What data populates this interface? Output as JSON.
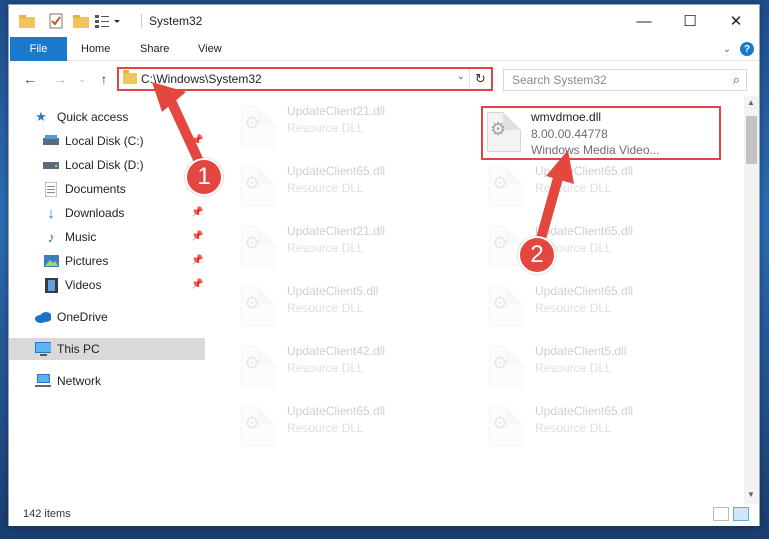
{
  "window": {
    "title": "System32",
    "controls": {
      "minimize": "—",
      "maximize": "☐",
      "close": "✕"
    }
  },
  "ribbon": {
    "file_tab": "File",
    "tabs": [
      "Home",
      "Share",
      "View"
    ]
  },
  "navbar": {
    "address_path": "C:\\Windows\\System32",
    "search_placeholder": "Search System32"
  },
  "sidebar": {
    "items": [
      {
        "label": "Quick access",
        "icon": "star-icon",
        "pinned": false
      },
      {
        "label": "Local Disk (C:)",
        "icon": "drive-icon",
        "pinned": true
      },
      {
        "label": "Local Disk (D:)",
        "icon": "drive-icon",
        "pinned": false
      },
      {
        "label": "Documents",
        "icon": "document-icon",
        "pinned": true
      },
      {
        "label": "Downloads",
        "icon": "download-icon",
        "pinned": true
      },
      {
        "label": "Music",
        "icon": "music-icon",
        "pinned": true
      },
      {
        "label": "Pictures",
        "icon": "picture-icon",
        "pinned": true
      },
      {
        "label": "Videos",
        "icon": "video-icon",
        "pinned": true
      },
      {
        "label": "OneDrive",
        "icon": "cloud-icon",
        "pinned": false
      },
      {
        "label": "This PC",
        "icon": "computer-icon",
        "pinned": false,
        "selected": true
      },
      {
        "label": "Network",
        "icon": "network-icon",
        "pinned": false
      }
    ]
  },
  "files": {
    "highlighted": {
      "name": "wmvdmoe.dll",
      "version": "8.00.00.44778",
      "description": "Windows Media Video..."
    },
    "left_column": [
      {
        "name": "UpdateClient21.dll",
        "type": "Resource DLL"
      },
      {
        "name": "UpdateClient65.dll",
        "type": "Resource DLL"
      },
      {
        "name": "UpdateClient21.dll",
        "type": "Resource DLL"
      },
      {
        "name": "UpdateClient5.dll",
        "type": "Resource DLL"
      },
      {
        "name": "UpdateClient42.dll",
        "type": "Resource DLL"
      },
      {
        "name": "UpdateClient65.dll",
        "type": "Resource DLL"
      }
    ],
    "right_column": [
      {
        "name": "UpdateClient65.dll",
        "type": "Resource DLL"
      },
      {
        "name": "UpdateClient65.dll",
        "type": "Resource DLL"
      },
      {
        "name": "UpdateClient65.dll",
        "type": "Resource DLL"
      },
      {
        "name": "UpdateClient5.dll",
        "type": "Resource DLL"
      },
      {
        "name": "UpdateClient65.dll",
        "type": "Resource DLL"
      }
    ]
  },
  "status": {
    "item_count": "142 items"
  },
  "annotations": {
    "step1": "1",
    "step2": "2",
    "color": "#e3473f"
  }
}
